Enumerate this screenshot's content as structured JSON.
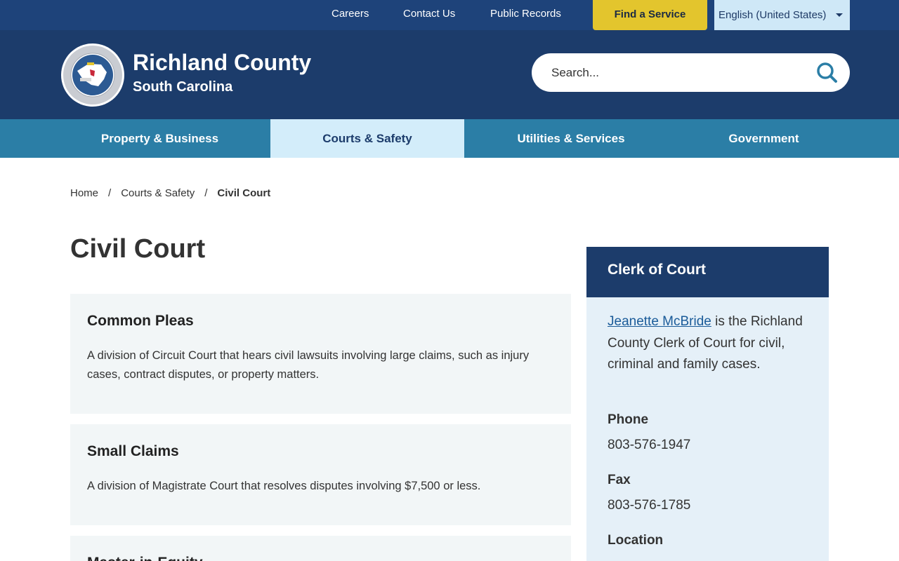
{
  "utility": {
    "careers": "Careers",
    "contact": "Contact Us",
    "records": "Public Records",
    "find_service": "Find a Service",
    "language": "English (United States)"
  },
  "header": {
    "title": "Richland County",
    "subtitle": "South Carolina",
    "search_placeholder": "Search..."
  },
  "nav": {
    "items": [
      {
        "label": "Property & Business"
      },
      {
        "label": "Courts & Safety"
      },
      {
        "label": "Utilities & Services"
      },
      {
        "label": "Government"
      }
    ]
  },
  "breadcrumb": {
    "home": "Home",
    "sep": "/",
    "section": "Courts & Safety",
    "current": "Civil Court"
  },
  "page": {
    "title": "Civil Court"
  },
  "cards": [
    {
      "title": "Common Pleas",
      "desc": "A division of Circuit Court that hears civil lawsuits involving large claims, such as injury cases, contract disputes, or property matters."
    },
    {
      "title": "Small Claims",
      "desc": "A division of Magistrate Court that resolves disputes involving $7,500 or less."
    },
    {
      "title": "Master-in-Equity"
    }
  ],
  "sidebar": {
    "title": "Clerk of Court",
    "clerk_name": "Jeanette McBride",
    "clerk_text": " is the Richland County Clerk of Court for civil, criminal and family cases.",
    "phone_label": "Phone",
    "phone": "803-576-1947",
    "fax_label": "Fax",
    "fax": "803-576-1785",
    "location_label": "Location"
  },
  "colors": {
    "utility_bar": "#1e437a",
    "header": "#1c3c6b",
    "nav": "#2b7ea6",
    "nav_active": "#d3edfa",
    "find_service": "#e3c52d",
    "card_bg": "#f2f6f7",
    "sidebar_bg": "#e5f0f8"
  }
}
